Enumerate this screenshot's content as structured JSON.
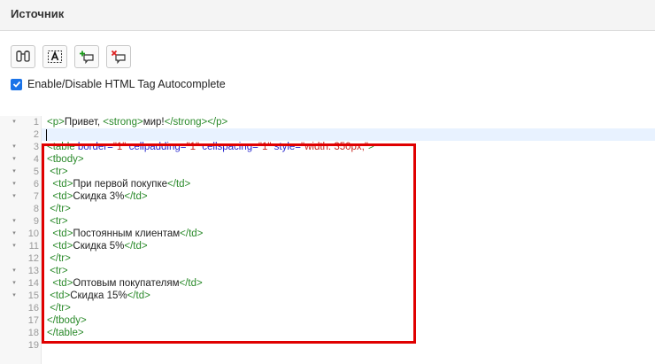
{
  "header": {
    "title": "Источник"
  },
  "toolbar": {
    "buttons": [
      {
        "name": "find-replace",
        "icon": "binoculars-icon"
      },
      {
        "name": "select-all",
        "icon": "select-text-icon"
      },
      {
        "name": "add-comment",
        "icon": "add-comment-icon"
      },
      {
        "name": "remove-comment",
        "icon": "remove-comment-icon"
      }
    ]
  },
  "autocomplete": {
    "label": "Enable/Disable HTML Tag Autocomplete",
    "checked": true
  },
  "editor": {
    "lines": [
      {
        "num": "1",
        "fold": true,
        "tokens": [
          {
            "t": "<p>",
            "c": "tag"
          },
          {
            "t": "Привет, ",
            "c": "txt"
          },
          {
            "t": "<strong>",
            "c": "tag"
          },
          {
            "t": "мир!",
            "c": "txt"
          },
          {
            "t": "</strong>",
            "c": "tag"
          },
          {
            "t": "</p>",
            "c": "tag"
          }
        ]
      },
      {
        "num": "2",
        "fold": false,
        "tokens": []
      },
      {
        "num": "3",
        "fold": true,
        "tokens": [
          {
            "t": "<table ",
            "c": "tag"
          },
          {
            "t": "border=",
            "c": "attr"
          },
          {
            "t": "\"1\"",
            "c": "str"
          },
          {
            "t": " cellpadding=",
            "c": "attr"
          },
          {
            "t": "\"1\"",
            "c": "str"
          },
          {
            "t": " cellspacing=",
            "c": "attr"
          },
          {
            "t": "\"1\"",
            "c": "str"
          },
          {
            "t": " style=",
            "c": "attr"
          },
          {
            "t": "\"width: 350px;\"",
            "c": "str"
          },
          {
            "t": ">",
            "c": "tag"
          }
        ]
      },
      {
        "num": "4",
        "fold": true,
        "tokens": [
          {
            "t": "<tbody>",
            "c": "tag"
          }
        ]
      },
      {
        "num": "5",
        "fold": true,
        "tokens": [
          {
            "t": " <tr>",
            "c": "tag"
          }
        ]
      },
      {
        "num": "6",
        "fold": true,
        "tokens": [
          {
            "t": "  <td>",
            "c": "tag"
          },
          {
            "t": "При первой покупке",
            "c": "txt"
          },
          {
            "t": "</td>",
            "c": "tag"
          }
        ]
      },
      {
        "num": "7",
        "fold": true,
        "tokens": [
          {
            "t": "  <td>",
            "c": "tag"
          },
          {
            "t": "Скидка 3%",
            "c": "txt"
          },
          {
            "t": "</td>",
            "c": "tag"
          }
        ]
      },
      {
        "num": "8",
        "fold": false,
        "tokens": [
          {
            "t": " </tr>",
            "c": "tag"
          }
        ]
      },
      {
        "num": "9",
        "fold": true,
        "tokens": [
          {
            "t": " <tr>",
            "c": "tag"
          }
        ]
      },
      {
        "num": "10",
        "fold": true,
        "tokens": [
          {
            "t": "  <td>",
            "c": "tag"
          },
          {
            "t": "Постоянным клиентам",
            "c": "txt"
          },
          {
            "t": "</td>",
            "c": "tag"
          }
        ]
      },
      {
        "num": "11",
        "fold": true,
        "tokens": [
          {
            "t": "  <td>",
            "c": "tag"
          },
          {
            "t": "Скидка 5%",
            "c": "txt"
          },
          {
            "t": "</td>",
            "c": "tag"
          }
        ]
      },
      {
        "num": "12",
        "fold": false,
        "tokens": [
          {
            "t": " </tr>",
            "c": "tag"
          }
        ]
      },
      {
        "num": "13",
        "fold": true,
        "tokens": [
          {
            "t": " <tr>",
            "c": "tag"
          }
        ]
      },
      {
        "num": "14",
        "fold": true,
        "tokens": [
          {
            "t": "  <td>",
            "c": "tag"
          },
          {
            "t": "Оптовым покупателям",
            "c": "txt"
          },
          {
            "t": "</td>",
            "c": "tag"
          }
        ]
      },
      {
        "num": "15",
        "fold": true,
        "tokens": [
          {
            "t": " <td>",
            "c": "tag"
          },
          {
            "t": "Скидка 15%",
            "c": "txt"
          },
          {
            "t": "</td>",
            "c": "tag"
          }
        ]
      },
      {
        "num": "16",
        "fold": false,
        "tokens": [
          {
            "t": " </tr>",
            "c": "tag"
          }
        ]
      },
      {
        "num": "17",
        "fold": false,
        "tokens": [
          {
            "t": "</tbody>",
            "c": "tag"
          }
        ]
      },
      {
        "num": "18",
        "fold": false,
        "tokens": [
          {
            "t": "</table>",
            "c": "tag"
          }
        ]
      },
      {
        "num": "19",
        "fold": false,
        "tokens": []
      }
    ]
  },
  "colors": {
    "tag": "#2a8a2a",
    "attr": "#2a2ad0",
    "string": "#c8261f",
    "highlight_border": "#e00000",
    "checkbox": "#1a73e8"
  }
}
